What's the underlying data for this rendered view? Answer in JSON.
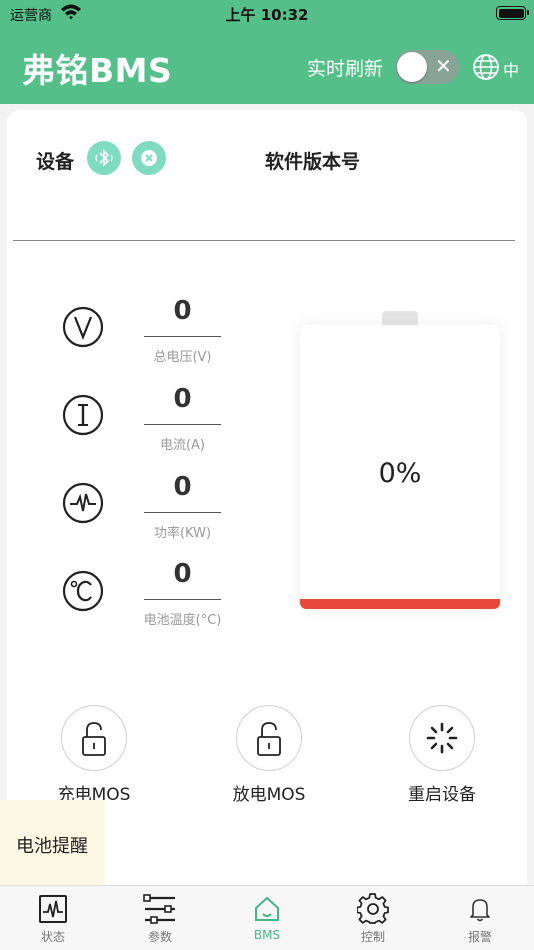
{
  "status_bar": {
    "carrier": "运营商",
    "time": "上午 10:32"
  },
  "header": {
    "title": "弗铭BMS",
    "refresh_label": "实时刷新",
    "lang": "中"
  },
  "device": {
    "label": "设备",
    "version_label": "软件版本号"
  },
  "metrics": [
    {
      "value": "0",
      "label": "总电压(V)"
    },
    {
      "value": "0",
      "label": "电流(A)"
    },
    {
      "value": "0",
      "label": "功率(KW)"
    },
    {
      "value": "0",
      "label": "电池温度(°C)"
    }
  ],
  "battery": {
    "percent_text": "0%",
    "level_fraction": 0.0,
    "fill_color": "#e8473a"
  },
  "controls": [
    {
      "label": "充电MOS"
    },
    {
      "label": "放电MOS"
    },
    {
      "label": "重启设备"
    }
  ],
  "toast": {
    "text": "电池提醒"
  },
  "tabs": [
    {
      "label": "状态",
      "icon": "waveform-icon",
      "active": false
    },
    {
      "label": "参数",
      "icon": "sliders-icon",
      "active": false
    },
    {
      "label": "BMS",
      "icon": "home-icon",
      "active": true
    },
    {
      "label": "控制",
      "icon": "gear-icon",
      "active": false
    },
    {
      "label": "报警",
      "icon": "bell-icon",
      "active": false
    }
  ],
  "colors": {
    "brand": "#55bf8a",
    "accent": "#7fdcc0",
    "active_tab": "#48b587"
  }
}
